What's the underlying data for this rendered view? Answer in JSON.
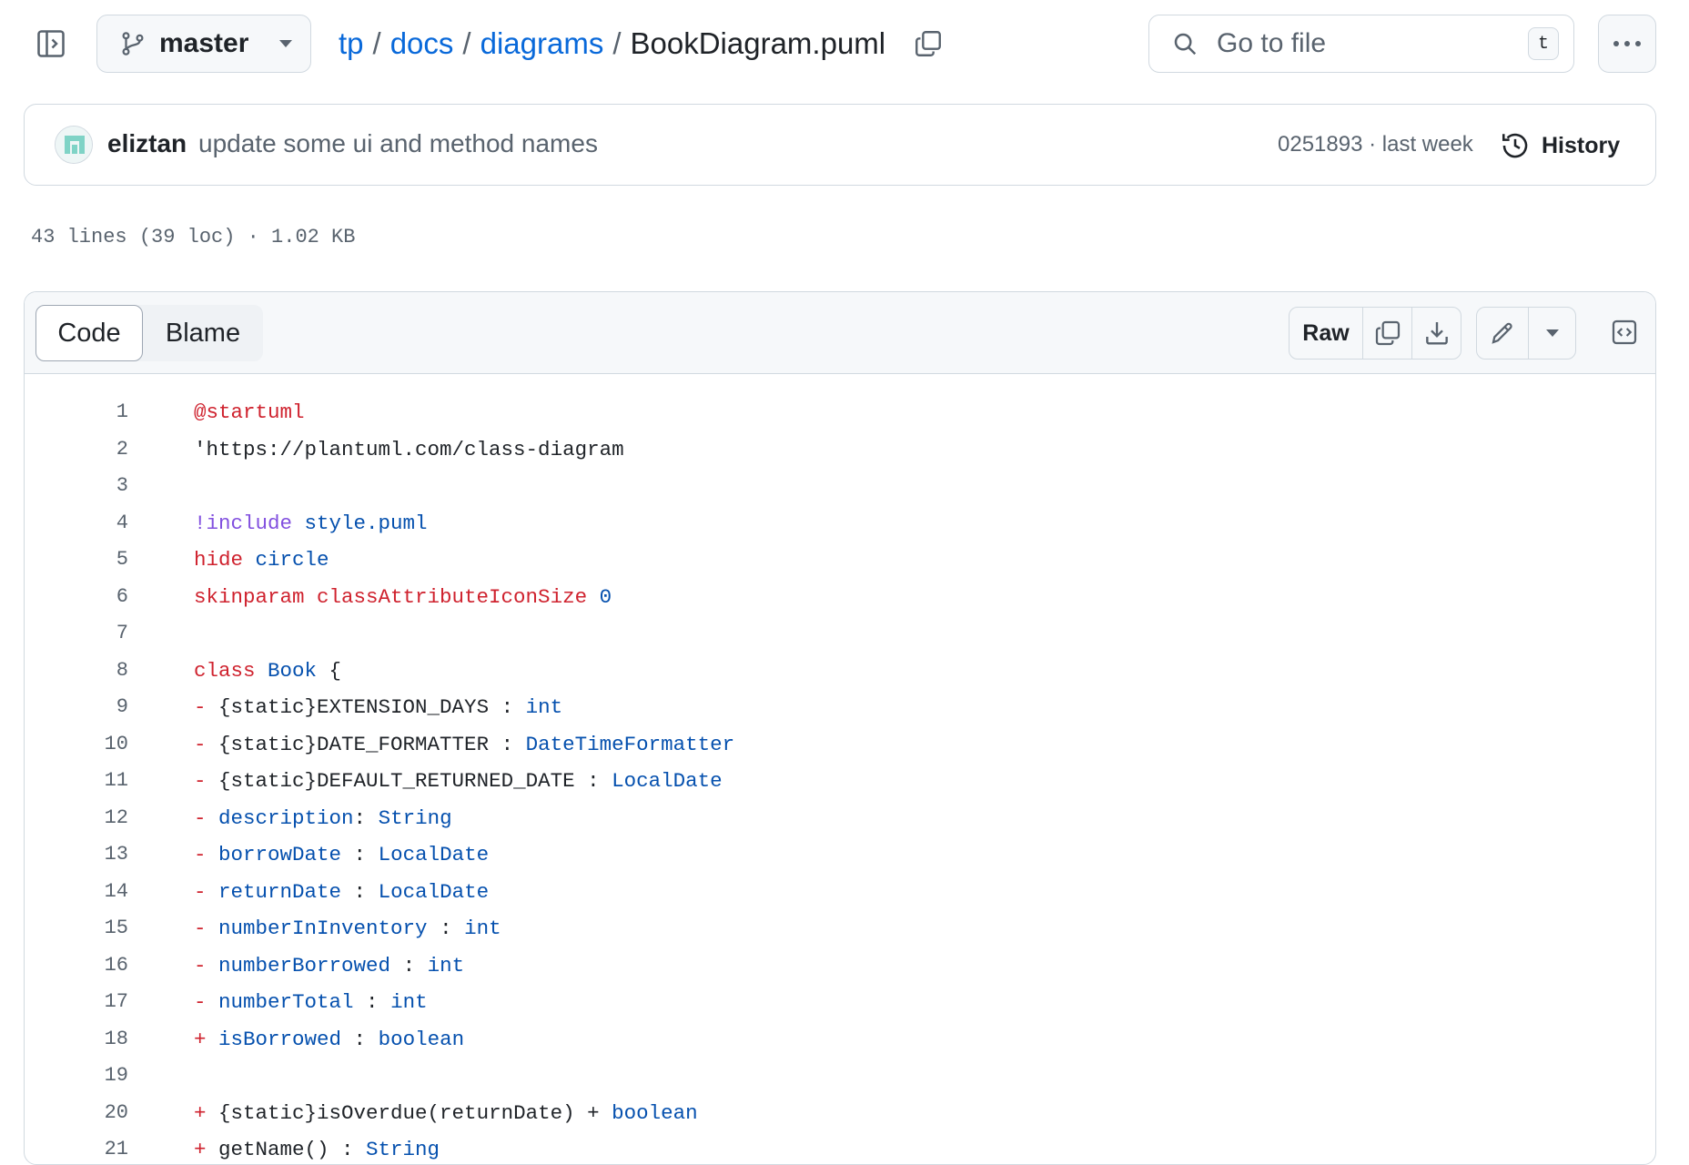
{
  "header": {
    "branch": "master",
    "breadcrumb": {
      "parts": [
        "tp",
        "docs",
        "diagrams"
      ],
      "separator": "/",
      "file": "BookDiagram.puml"
    },
    "search": {
      "placeholder": "Go to file",
      "shortcut": "t"
    },
    "icons": [
      "sidebar-toggle-icon",
      "git-branch-icon",
      "caret-down-icon",
      "copy-icon",
      "search-icon",
      "kebab-horizontal-icon"
    ]
  },
  "commit": {
    "author": "eliztan",
    "message": "update some ui and method names",
    "sha_time": "0251893 · last week",
    "history_label": "History"
  },
  "file_info": "43 lines (39 loc) · 1.02 KB",
  "viewer": {
    "tabs": [
      "Code",
      "Blame"
    ],
    "active_tab": "Code",
    "raw_label": "Raw",
    "icons": [
      "copy-icon",
      "download-icon",
      "pencil-icon",
      "caret-down-icon",
      "code-square-icon"
    ]
  },
  "colors": {
    "link": "#0969da",
    "keyword_red": "#cf222e",
    "identifier_blue": "#0550ae",
    "directive_purple": "#8250df",
    "muted": "#59636e"
  },
  "code": [
    {
      "n": "1",
      "tokens": [
        {
          "t": "@startuml",
          "c": "red"
        }
      ]
    },
    {
      "n": "2",
      "tokens": [
        {
          "t": "'https://plantuml.com/class-diagram",
          "c": "plain"
        }
      ]
    },
    {
      "n": "3",
      "tokens": []
    },
    {
      "n": "4",
      "tokens": [
        {
          "t": "!include",
          "c": "purple"
        },
        {
          "t": " style.puml",
          "c": "blue"
        }
      ]
    },
    {
      "n": "5",
      "tokens": [
        {
          "t": "hide",
          "c": "red"
        },
        {
          "t": " circle",
          "c": "blue"
        }
      ]
    },
    {
      "n": "6",
      "tokens": [
        {
          "t": "skinparam classAttributeIconSize",
          "c": "red"
        },
        {
          "t": " 0",
          "c": "blue"
        }
      ]
    },
    {
      "n": "7",
      "tokens": []
    },
    {
      "n": "8",
      "tokens": [
        {
          "t": "class",
          "c": "red"
        },
        {
          "t": " Book",
          "c": "blue"
        },
        {
          "t": " {",
          "c": "plain"
        }
      ]
    },
    {
      "n": "9",
      "tokens": [
        {
          "t": "-",
          "c": "red"
        },
        {
          "t": " {static}EXTENSION_DAYS : ",
          "c": "plain"
        },
        {
          "t": "int",
          "c": "blue"
        }
      ]
    },
    {
      "n": "10",
      "tokens": [
        {
          "t": "-",
          "c": "red"
        },
        {
          "t": " {static}DATE_FORMATTER : ",
          "c": "plain"
        },
        {
          "t": "DateTimeFormatter",
          "c": "blue"
        }
      ]
    },
    {
      "n": "11",
      "tokens": [
        {
          "t": "-",
          "c": "red"
        },
        {
          "t": " {static}DEFAULT_RETURNED_DATE : ",
          "c": "plain"
        },
        {
          "t": "LocalDate",
          "c": "blue"
        }
      ]
    },
    {
      "n": "12",
      "tokens": [
        {
          "t": "-",
          "c": "red"
        },
        {
          "t": " description",
          "c": "blue"
        },
        {
          "t": ": ",
          "c": "plain"
        },
        {
          "t": "String",
          "c": "blue"
        }
      ]
    },
    {
      "n": "13",
      "tokens": [
        {
          "t": "-",
          "c": "red"
        },
        {
          "t": " borrowDate",
          "c": "blue"
        },
        {
          "t": " : ",
          "c": "plain"
        },
        {
          "t": "LocalDate",
          "c": "blue"
        }
      ]
    },
    {
      "n": "14",
      "tokens": [
        {
          "t": "-",
          "c": "red"
        },
        {
          "t": " returnDate",
          "c": "blue"
        },
        {
          "t": " : ",
          "c": "plain"
        },
        {
          "t": "LocalDate",
          "c": "blue"
        }
      ]
    },
    {
      "n": "15",
      "tokens": [
        {
          "t": "-",
          "c": "red"
        },
        {
          "t": " numberInInventory",
          "c": "blue"
        },
        {
          "t": " : ",
          "c": "plain"
        },
        {
          "t": "int",
          "c": "blue"
        }
      ]
    },
    {
      "n": "16",
      "tokens": [
        {
          "t": "-",
          "c": "red"
        },
        {
          "t": " numberBorrowed",
          "c": "blue"
        },
        {
          "t": " : ",
          "c": "plain"
        },
        {
          "t": "int",
          "c": "blue"
        }
      ]
    },
    {
      "n": "17",
      "tokens": [
        {
          "t": "-",
          "c": "red"
        },
        {
          "t": " numberTotal",
          "c": "blue"
        },
        {
          "t": " : ",
          "c": "plain"
        },
        {
          "t": "int",
          "c": "blue"
        }
      ]
    },
    {
      "n": "18",
      "tokens": [
        {
          "t": "+",
          "c": "red"
        },
        {
          "t": " isBorrowed",
          "c": "blue"
        },
        {
          "t": " : ",
          "c": "plain"
        },
        {
          "t": "boolean",
          "c": "blue"
        }
      ]
    },
    {
      "n": "19",
      "tokens": []
    },
    {
      "n": "20",
      "tokens": [
        {
          "t": "+",
          "c": "red"
        },
        {
          "t": " {static}isOverdue(returnDate) + ",
          "c": "plain"
        },
        {
          "t": "boolean",
          "c": "blue"
        }
      ]
    },
    {
      "n": "21",
      "tokens": [
        {
          "t": "+",
          "c": "red"
        },
        {
          "t": " getName() : ",
          "c": "plain"
        },
        {
          "t": "String",
          "c": "blue"
        }
      ]
    }
  ]
}
